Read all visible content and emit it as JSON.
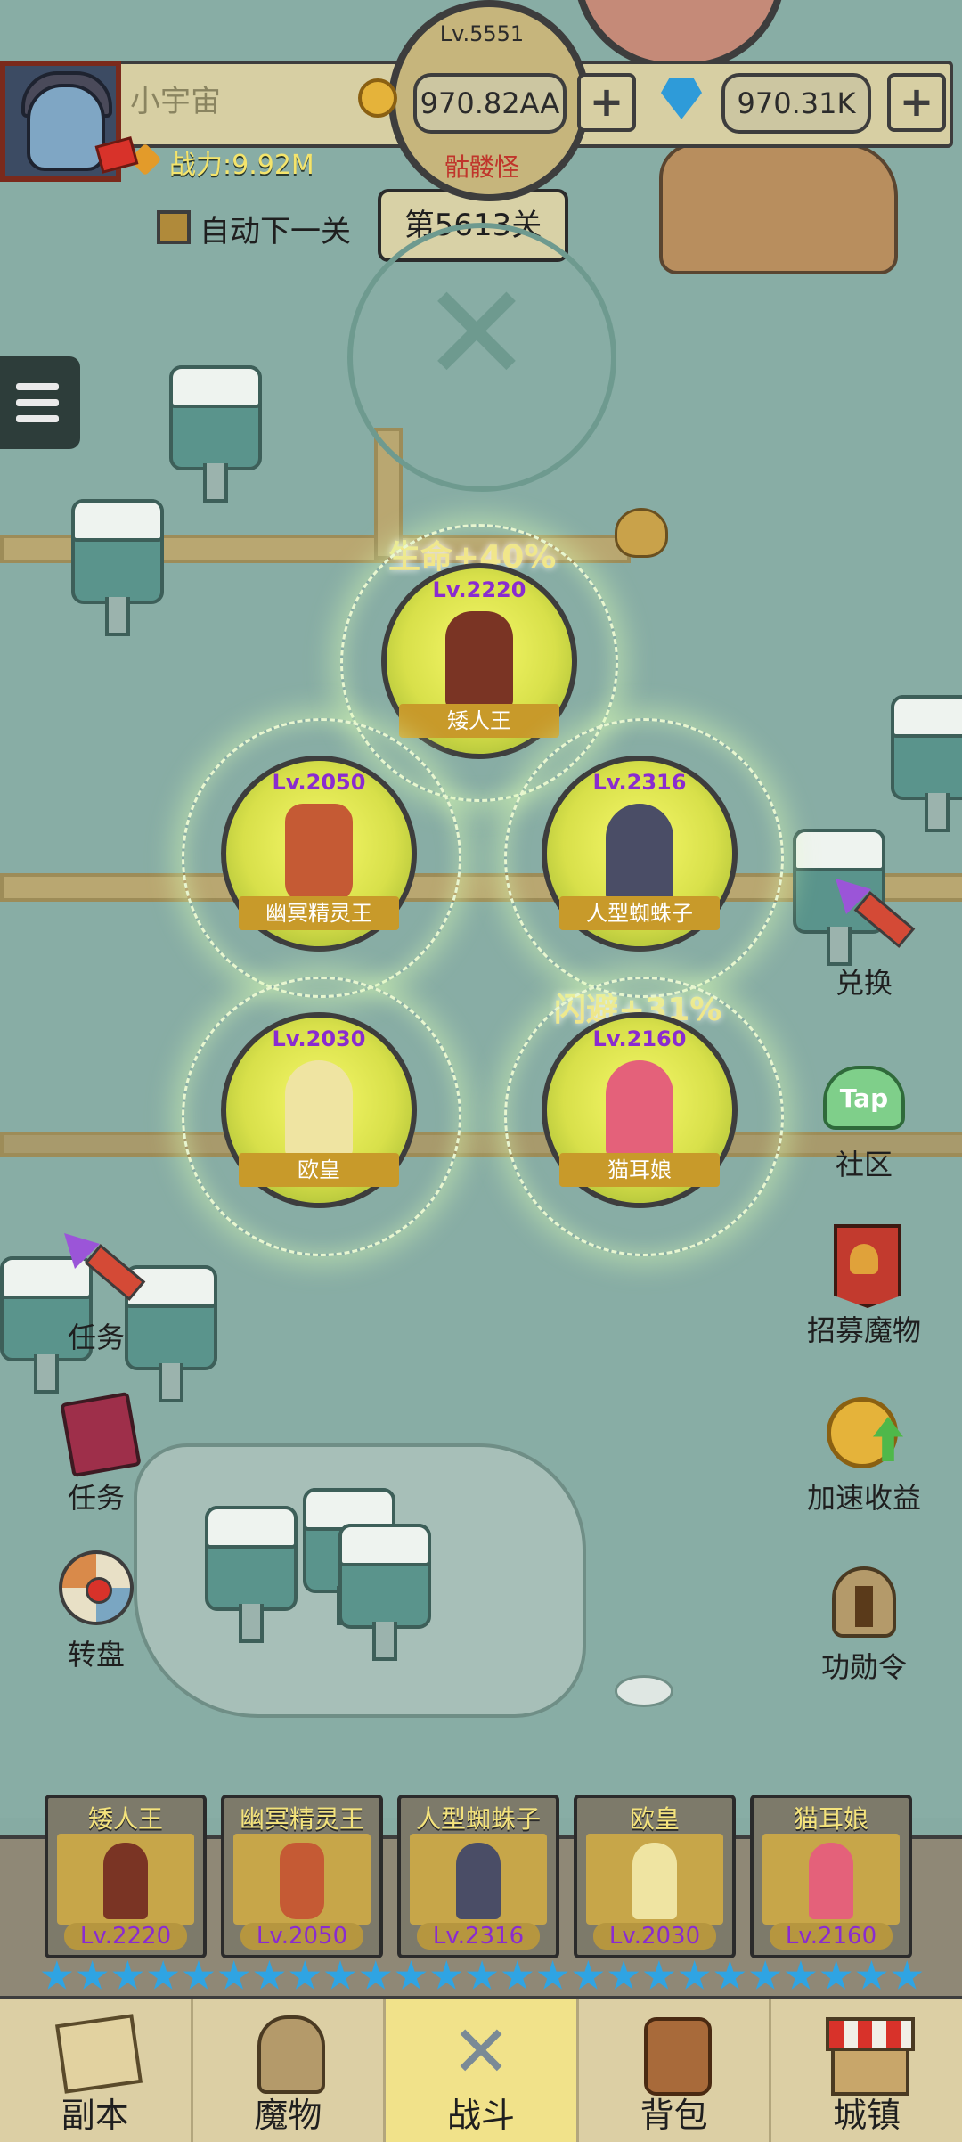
{
  "player": {
    "name": "小宇宙",
    "power": "战力:9.92M"
  },
  "currency": {
    "gold": "970.82AA",
    "gems": "970.31K",
    "plus": "+"
  },
  "boss": {
    "level": "Lv.5551",
    "name": "骷髅怪"
  },
  "stage": {
    "auto_label": "自动下一关",
    "label": "第5613关"
  },
  "bonuses": {
    "life": "生命+40%",
    "dodge": "闪避+31%"
  },
  "heroes": [
    {
      "name": "矮人王",
      "level": "Lv.2220",
      "color": "#8b3b2a"
    },
    {
      "name": "幽冥精灵王",
      "level": "Lv.2050",
      "color": "#c0552f"
    },
    {
      "name": "人型蜘蛛子",
      "level": "Lv.2316",
      "color": "#4a4d66"
    },
    {
      "name": "欧皇",
      "level": "Lv.2030",
      "color": "#f2e8a8"
    },
    {
      "name": "猫耳娘",
      "level": "Lv.2160",
      "color": "#e4617a"
    }
  ],
  "side_left": [
    {
      "label": "任务",
      "icon": "firework-icon"
    },
    {
      "label": "任务",
      "icon": "book-icon"
    },
    {
      "label": "转盘",
      "icon": "wheel-icon"
    }
  ],
  "side_right": [
    {
      "label": "兑换",
      "icon": "firework-icon"
    },
    {
      "label": "社区",
      "icon": "tap-icon",
      "icon_text": "Tap"
    },
    {
      "label": "招募魔物",
      "icon": "banner-helmet-icon"
    },
    {
      "label": "加速收益",
      "icon": "coin-up-icon"
    },
    {
      "label": "功勋令",
      "icon": "helmet-icon"
    }
  ],
  "stars_count": 25,
  "nav": [
    {
      "label": "副本",
      "icon": "map-icon"
    },
    {
      "label": "魔物",
      "icon": "monster-helmet-icon"
    },
    {
      "label": "战斗",
      "icon": "swords-icon",
      "active": true
    },
    {
      "label": "背包",
      "icon": "backpack-icon"
    },
    {
      "label": "城镇",
      "icon": "shop-icon"
    }
  ]
}
